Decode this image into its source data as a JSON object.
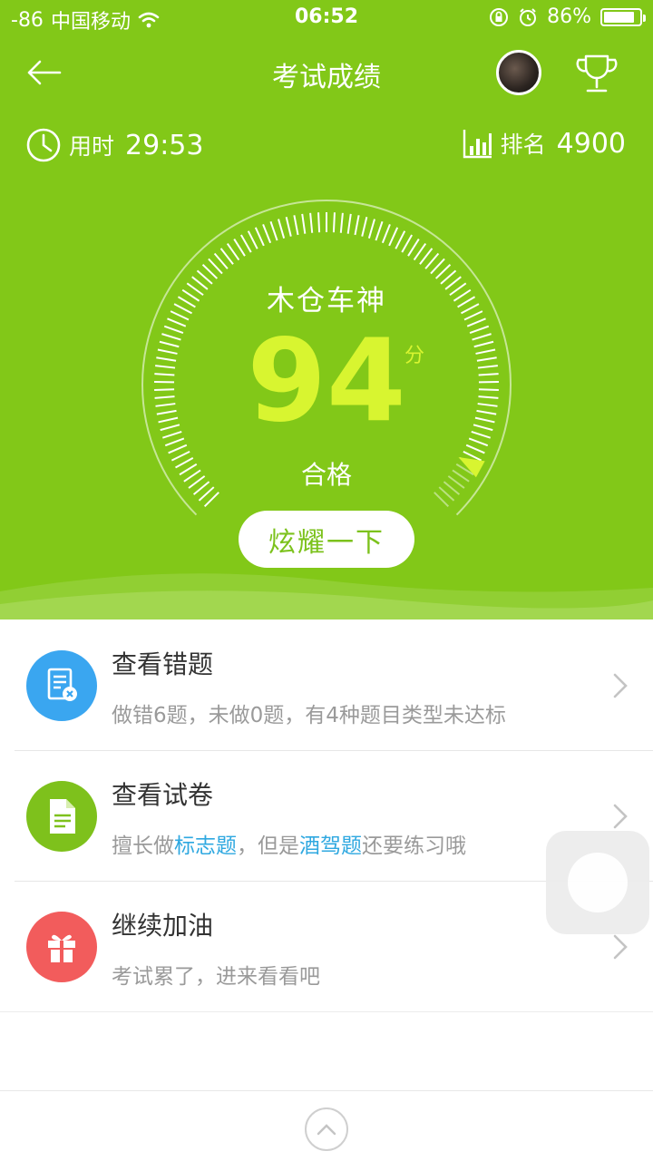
{
  "status_bar": {
    "signal": "-86",
    "carrier": "中国移动",
    "time": "06:52",
    "battery_pct": "86%",
    "battery_level": 0.86
  },
  "nav": {
    "title": "考试成绩"
  },
  "stats": {
    "time_label": "用时",
    "time_value": "29:53",
    "rank_label": "排名",
    "rank_value": "4900"
  },
  "gauge": {
    "user_name": "木仓车神",
    "score": "94",
    "unit": "分",
    "result": "合格",
    "score_fraction": 0.94
  },
  "share_button": "炫耀一下",
  "list": {
    "items": [
      {
        "title": "查看错题",
        "subtitle": "做错6题，未做0题，有4种题目类型未达标",
        "icon": "wrong-questions-icon",
        "color": "#3aa6f0"
      },
      {
        "title": "查看试卷",
        "subtitle_parts": [
          "擅长做",
          "标志题",
          "，但是",
          "酒驾题",
          "还要练习哦"
        ],
        "icon": "document-icon",
        "color": "#7ec11c"
      },
      {
        "title": "继续加油",
        "subtitle": "考试累了，进来看看吧",
        "icon": "gift-icon",
        "color": "#f25c5c"
      }
    ]
  },
  "colors": {
    "primary_green": "#82c818",
    "score_yellow": "#d8f530",
    "highlight_blue": "#2fa8e0"
  }
}
